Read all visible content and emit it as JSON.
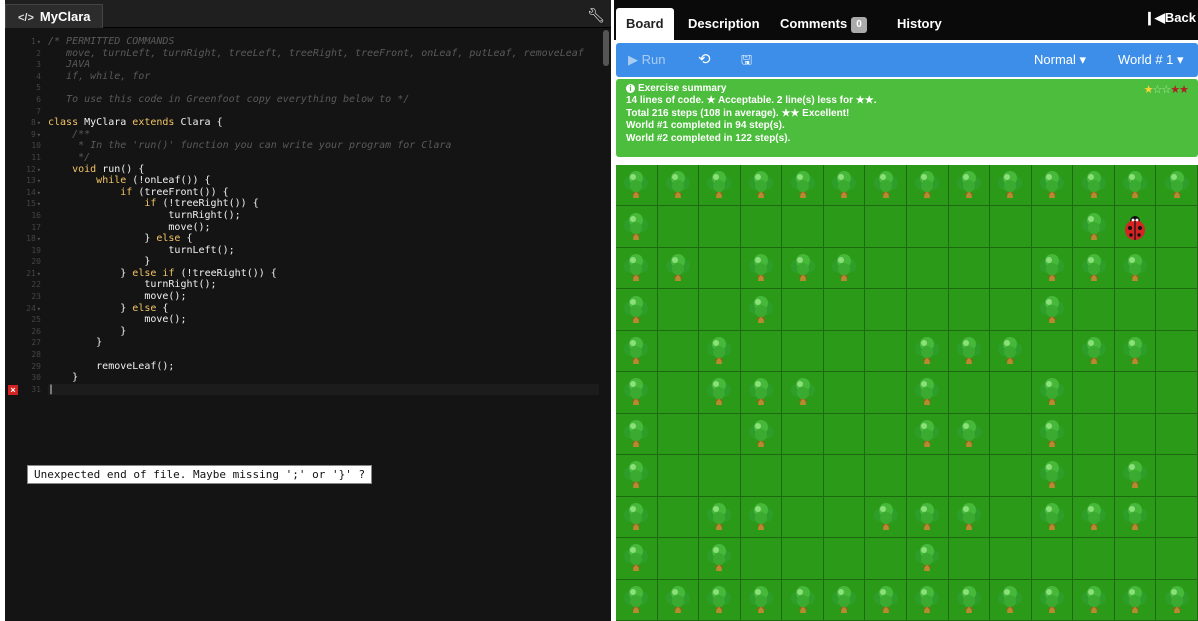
{
  "editor": {
    "tab_icon": "</>",
    "tab_label": "MyClara",
    "settings_icon": "wrench-icon",
    "error_tooltip": "Unexpected end of file. Maybe missing ';' or '}' ?",
    "error_line": 31,
    "lines": [
      {
        "n": 1,
        "fold": true,
        "type": "comment",
        "text": "/* PERMITTED COMMANDS"
      },
      {
        "n": 2,
        "type": "comment",
        "text": "   move, turnLeft, turnRight, treeLeft, treeRight, treeFront, onLeaf, putLeaf, removeLeaf"
      },
      {
        "n": 3,
        "type": "comment",
        "text": "   JAVA"
      },
      {
        "n": 4,
        "type": "comment",
        "text": "   if, while, for"
      },
      {
        "n": 5,
        "type": "comment",
        "text": ""
      },
      {
        "n": 6,
        "type": "comment",
        "text": "   To use this code in Greenfoot copy everything below to */"
      },
      {
        "n": 7,
        "type": "code",
        "text": ""
      },
      {
        "n": 8,
        "fold": true,
        "type": "class",
        "text": "class MyClara extends Clara {"
      },
      {
        "n": 9,
        "fold": true,
        "type": "comment",
        "text": "    /**"
      },
      {
        "n": 10,
        "type": "comment",
        "text": "     * In the 'run()' function you can write your program for Clara"
      },
      {
        "n": 11,
        "type": "comment",
        "text": "     */"
      },
      {
        "n": 12,
        "fold": true,
        "type": "code",
        "text": "    void run() {"
      },
      {
        "n": 13,
        "fold": true,
        "type": "code",
        "text": "        while (!onLeaf()) {"
      },
      {
        "n": 14,
        "fold": true,
        "type": "code",
        "text": "            if (treeFront()) {"
      },
      {
        "n": 15,
        "fold": true,
        "type": "code",
        "text": "                if (!treeRight()) {"
      },
      {
        "n": 16,
        "type": "code",
        "text": "                    turnRight();"
      },
      {
        "n": 17,
        "type": "code",
        "text": "                    move();"
      },
      {
        "n": 18,
        "fold": true,
        "type": "code",
        "text": "                } else {"
      },
      {
        "n": 19,
        "type": "code",
        "text": "                    turnLeft();"
      },
      {
        "n": 20,
        "type": "code",
        "text": "                }"
      },
      {
        "n": 21,
        "fold": true,
        "type": "code",
        "text": "            } else if (!treeRight()) {"
      },
      {
        "n": 22,
        "type": "code",
        "text": "                turnRight();"
      },
      {
        "n": 23,
        "type": "code",
        "text": "                move();"
      },
      {
        "n": 24,
        "fold": true,
        "type": "code",
        "text": "            } else {"
      },
      {
        "n": 25,
        "type": "code",
        "text": "                move();"
      },
      {
        "n": 26,
        "type": "code",
        "text": "            }"
      },
      {
        "n": 27,
        "type": "code",
        "text": "        }"
      },
      {
        "n": 28,
        "type": "code",
        "text": ""
      },
      {
        "n": 29,
        "type": "code",
        "text": "        removeLeaf();"
      },
      {
        "n": 30,
        "type": "code",
        "text": "    }"
      },
      {
        "n": 31,
        "type": "code",
        "text": "|",
        "active": true
      }
    ]
  },
  "game": {
    "tabs": [
      {
        "label": "Board",
        "active": true
      },
      {
        "label": "Description"
      },
      {
        "label": "Comments",
        "badge": "0"
      },
      {
        "label": "History"
      }
    ],
    "back_label": "Back",
    "toolbar": {
      "run_label": "Run",
      "reset_icon": "reset-icon",
      "save_icon": "save-icon",
      "speed_label": "Normal",
      "world_label": "World # 1"
    },
    "summary": {
      "title": "Exercise summary",
      "lines": [
        "14 lines of code. ★ Acceptable. 2 line(s) less for ★★.",
        "Total 216 steps (108 in average). ★★ Excellent!",
        "World #1 completed in 94 step(s).",
        "World #2 completed in 122 step(s)."
      ],
      "rating_filled": 1,
      "rating_total": 5
    },
    "board": {
      "columns": 14,
      "rows": 11,
      "grid": [
        "TTTTTTTTTTTTTT",
        "T..........TC.",
        "TT.TTT....TTT.T",
        "T..T......T...T",
        "T.T....TTT.TT.T",
        "T.TTT..T..T...T",
        "T..T...TT.T...T",
        "T.........T.T.T",
        "T.TT..TTT.TTT.T",
        "T.T....T......T",
        "TTTTTTTTTTTTTT"
      ]
    }
  }
}
